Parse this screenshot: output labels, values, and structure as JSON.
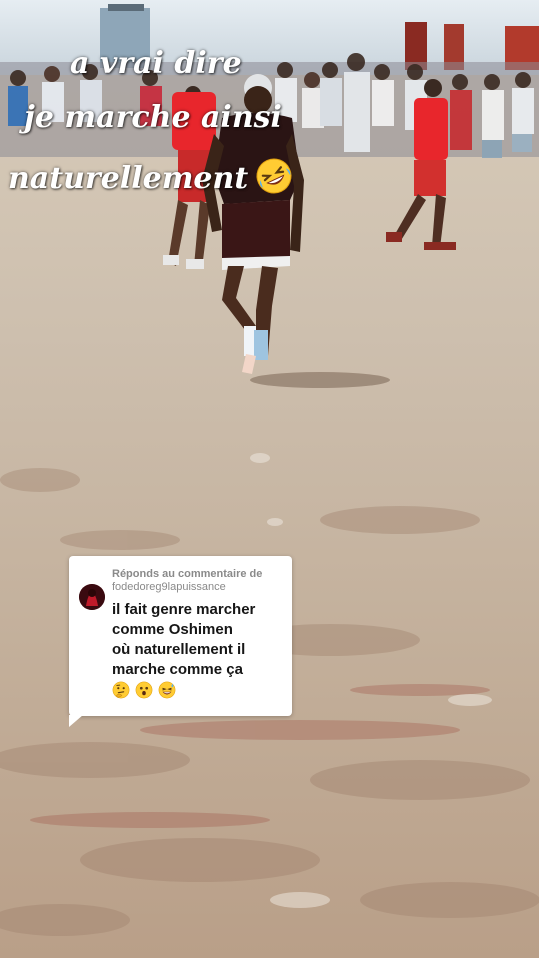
{
  "overlay_caption": {
    "line1": "a vrai dire",
    "line2": "je marche ainsi",
    "line3": "naturellement",
    "line3_emoji": "rolling-on-floor-laughing-emoji"
  },
  "reply_card": {
    "header": "Réponds au commentaire de",
    "username": "fodedoreg9lapuissance",
    "comment": [
      "il fait genre marcher",
      "comme Oshimen",
      "où naturellement il",
      "marche comme ça"
    ],
    "emojis": [
      "thinking-face-emoji",
      "astonished-face-emoji",
      "grinning-sweat-emoji"
    ]
  },
  "colors": {
    "caption_text": "#ffffff",
    "card_background": "#ffffff",
    "card_header_text": "#8a8a8a",
    "card_body_text": "#161616",
    "ground": "#c9b9a6",
    "jersey_red": "#e8262c",
    "jersey_black": "#2a1414"
  }
}
